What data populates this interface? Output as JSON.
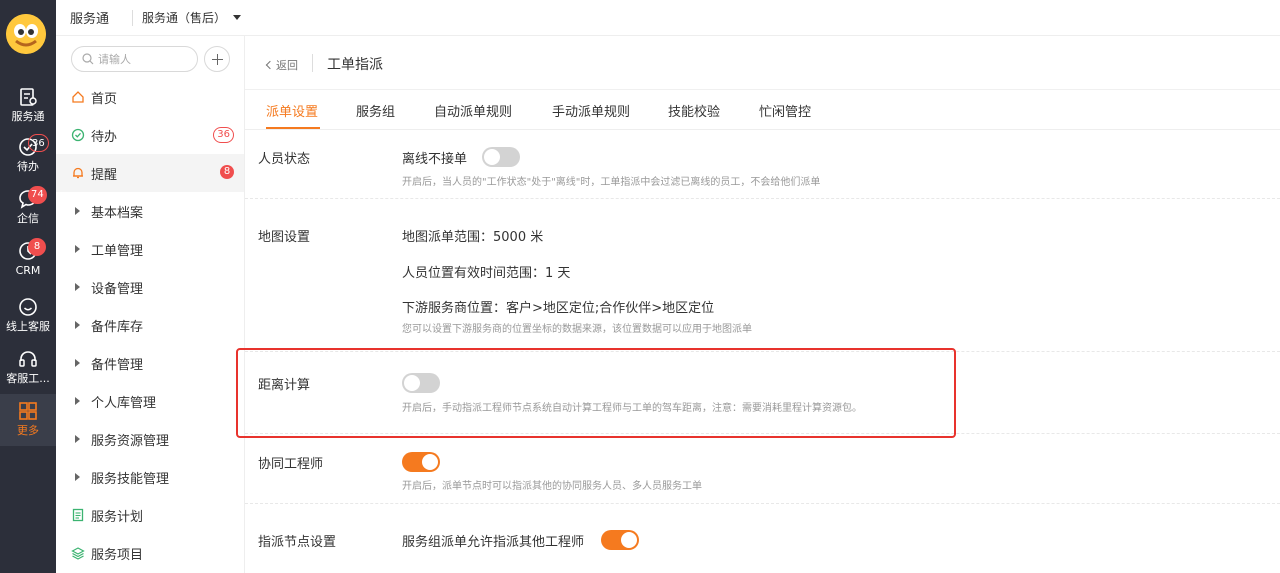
{
  "rail": {
    "items": [
      {
        "label": "服务通",
        "badge": ""
      },
      {
        "label": "待办",
        "badge": "36"
      },
      {
        "label": "企信",
        "badge": "74"
      },
      {
        "label": "CRM",
        "badge": "8"
      },
      {
        "label": "线上客服",
        "badge": ""
      },
      {
        "label": "客服工...",
        "badge": ""
      },
      {
        "label": "更多",
        "badge": ""
      }
    ]
  },
  "topbar": {
    "app_name": "服务通",
    "app_selector": "服务通（售后）"
  },
  "sidenav": {
    "search_placeholder": "请输人",
    "items": [
      {
        "label": "首页",
        "badge": ""
      },
      {
        "label": "待办",
        "badge": "36"
      },
      {
        "label": "提醒",
        "badge": "8"
      },
      {
        "label": "基本档案",
        "badge": ""
      },
      {
        "label": "工单管理",
        "badge": ""
      },
      {
        "label": "设备管理",
        "badge": ""
      },
      {
        "label": "备件库存",
        "badge": ""
      },
      {
        "label": "备件管理",
        "badge": ""
      },
      {
        "label": "个人库管理",
        "badge": ""
      },
      {
        "label": "服务资源管理",
        "badge": ""
      },
      {
        "label": "服务技能管理",
        "badge": ""
      },
      {
        "label": "服务计划",
        "badge": ""
      },
      {
        "label": "服务项目",
        "badge": ""
      }
    ]
  },
  "page": {
    "back_label": "返回",
    "title": "工单指派",
    "tabs": [
      "派单设置",
      "服务组",
      "自动派单规则",
      "手动派单规则",
      "技能校验",
      "忙闲管控"
    ]
  },
  "settings": {
    "personnel": {
      "label": "人员状态",
      "option": "离线不接单",
      "toggle_on": false,
      "hint": "开启后，当人员的\"工作状态\"处于\"离线\"时，工单指派中会过滤已离线的员工，不会给他们派单"
    },
    "map": {
      "label": "地图设置",
      "range": "地图派单范围：5000 米",
      "valid_time": "人员位置有效时间范围：1 天",
      "downstream": "下游服务商位置：客户>地区定位;合作伙伴>地区定位",
      "hint": "您可以设置下游服务商的位置坐标的数据来源，该位置数据可以应用于地图派单"
    },
    "distance": {
      "label": "距离计算",
      "toggle_on": false,
      "hint": "开启后，手动指派工程师节点系统自动计算工程师与工单的驾车距离，注意：需要消耗里程计算资源包。"
    },
    "collab": {
      "label": "协同工程师",
      "toggle_on": true,
      "hint": "开启后，派单节点时可以指派其他的协同服务人员、多人员服务工单"
    },
    "assign_node": {
      "label": "指派节点设置",
      "option": "服务组派单允许指派其他工程师",
      "toggle_on": true
    }
  },
  "colors": {
    "accent": "#f57a1f",
    "rail_bg": "#2c2f3a",
    "badge_red": "#f04e4e",
    "highlight_red": "#e8332d"
  }
}
